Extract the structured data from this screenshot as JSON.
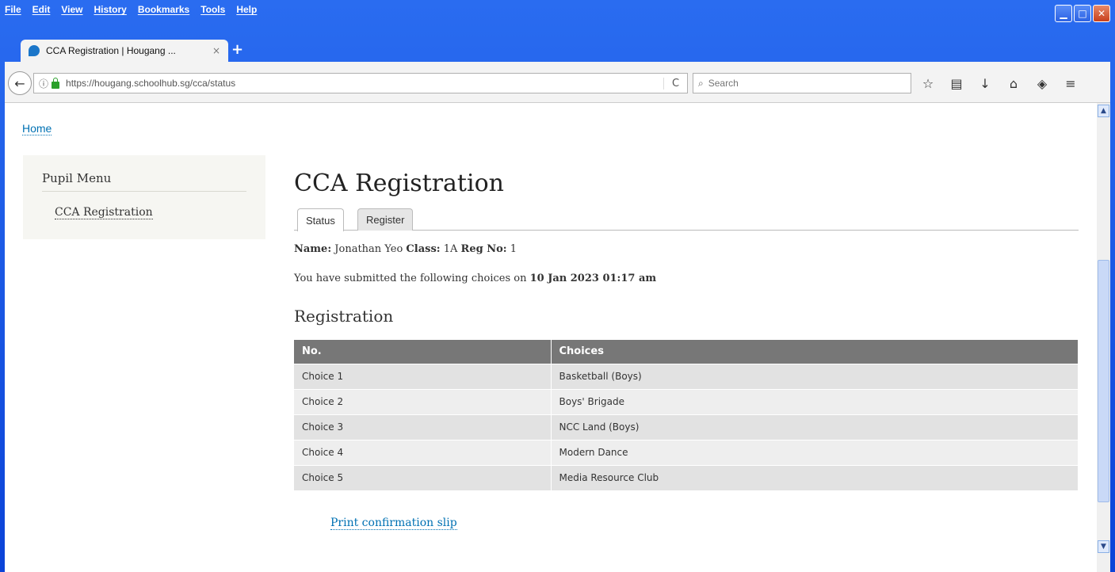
{
  "menubar": {
    "items": [
      "File",
      "Edit",
      "View",
      "History",
      "Bookmarks",
      "Tools",
      "Help"
    ]
  },
  "window_buttons": {
    "minimize": "▁",
    "maximize": "□",
    "close": "✕"
  },
  "browser": {
    "tab_title": "CCA Registration | Hougang ...",
    "tab_close": "×",
    "new_tab": "+",
    "back": "←",
    "info_glyph": "ⓘ",
    "url": "https://hougang.schoolhub.sg/cca/status",
    "reload": "C",
    "search_placeholder": "Search",
    "search_glyph": "⌕",
    "toolbar_icons": [
      "☆",
      "▤",
      "↓",
      "⌂",
      "◈",
      "≡"
    ]
  },
  "page": {
    "breadcrumb": "Home",
    "sidebar": {
      "title": "Pupil Menu",
      "link": "CCA Registration"
    },
    "title": "CCA Registration",
    "tabs": {
      "status": "Status",
      "register": "Register"
    },
    "meta": {
      "name_label": "Name:",
      "name": "Jonathan Yeo",
      "class_label": "Class:",
      "class": "1A",
      "reg_label": "Reg No:",
      "reg": "1"
    },
    "submitted_text": "You have submitted the following choices on",
    "submitted_date": "10 Jan 2023 01:17 am",
    "section_title": "Registration",
    "table": {
      "headers": [
        "No.",
        "Choices"
      ],
      "rows": [
        [
          "Choice 1",
          "Basketball (Boys)"
        ],
        [
          "Choice 2",
          "Boys' Brigade"
        ],
        [
          "Choice 3",
          "NCC Land (Boys)"
        ],
        [
          "Choice 4",
          "Modern Dance"
        ],
        [
          "Choice 5",
          "Media Resource Club"
        ]
      ]
    },
    "print_link": "Print confirmation slip"
  }
}
